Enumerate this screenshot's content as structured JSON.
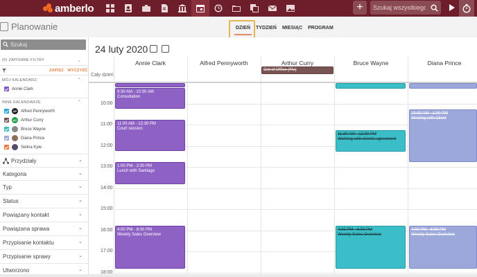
{
  "app": {
    "logo_text": "amberlo"
  },
  "topbar": {
    "nav_icons": [
      "dashboard-icon",
      "contact-icon",
      "briefcase-icon",
      "document-icon",
      "bank-icon",
      "calendar-icon",
      "history-icon",
      "folder-icon",
      "copy-icon",
      "mail-icon",
      "image-icon"
    ],
    "active_icon": "calendar-icon",
    "add_label": "+",
    "search_placeholder": "Szukaj wszystkiego..."
  },
  "header": {
    "title": "Planowanie",
    "tabs": [
      {
        "label": "DZIEŃ",
        "active": true
      },
      {
        "label": "TYDZIEŃ",
        "active": false
      },
      {
        "label": "MIESIĄC",
        "active": false
      },
      {
        "label": "PROGRAM",
        "active": false
      }
    ]
  },
  "sidebar": {
    "search_placeholder": "Szukaj",
    "saved_filters": "(0) ZAPISANE FILTRY",
    "save_label": "ZAPISZ",
    "clear_label": "WYCZYŚĆ",
    "my_calendar_title": "MÓJ KALENDARZ",
    "my_calendar": [
      {
        "name": "Annie Clark",
        "color": "#7e57c2"
      }
    ],
    "other_calendars_title": "INNE KALENDARZE",
    "other_calendars": [
      {
        "name": "Alfred Pennyworth",
        "color": "#29a8d8",
        "avatar": "AP",
        "avatar_color": "#222222"
      },
      {
        "name": "Arthur Curry",
        "color": "#7a5454",
        "avatar": "AC",
        "avatar_color": "#1e9e4a"
      },
      {
        "name": "Bruce Wayne",
        "color": "#3bbec8",
        "avatar": "",
        "avatar_color": "#888888"
      },
      {
        "name": "Diana Prince",
        "color": "#9ca7da",
        "avatar": "",
        "avatar_color": "#8a6f5a"
      },
      {
        "name": "Selina Kyle",
        "color": "#f0793a",
        "avatar": "",
        "avatar_color": "#5a4a6a"
      }
    ],
    "filters": [
      "Przydziały",
      "Kategoria",
      "Typ",
      "Status",
      "Powiązany kontakt",
      "Powiązana sprawa",
      "Przypisanie kontaktu",
      "Przypisanie sprawy",
      "Utworzono"
    ]
  },
  "calendar": {
    "date_title": "24 luty 2020",
    "all_day_label": "Cały dzień",
    "columns": [
      "Annie Clark",
      "Alfred Pennyworth",
      "Arthur Curry",
      "Bruce Wayne",
      "Diana Prince"
    ],
    "hours": [
      "10:00",
      "11:00",
      "12:00",
      "13:00",
      "14:00",
      "15:00",
      "16:00",
      "17:00",
      "18:00"
    ],
    "all_day_event": "Out of Office (Flu)",
    "events": [
      {
        "time": "9:30 AM - 10:30 AM",
        "title": "Consultation"
      },
      {
        "time": "11:00 AM - 12:30 PM",
        "title": "Court session"
      },
      {
        "time": "1:00 PM - 2:00 PM",
        "title": "Lunch with Santiago"
      },
      {
        "time": "4:00 PM - 6:00 PM",
        "title": "Weekly Sales Overview"
      },
      {
        "time": "11:30 AM - 12:30 PM",
        "title": "Working with client's agreement"
      },
      {
        "time": "4:00 PM - 6:00 PM",
        "title": "Weekly Sales Overview"
      },
      {
        "time": "10:30 AM - 1:00 PM",
        "title": "Meeting with Client"
      },
      {
        "time": "4:00 PM - 6:00 PM",
        "title": "Weekly Sales Overview"
      }
    ]
  }
}
